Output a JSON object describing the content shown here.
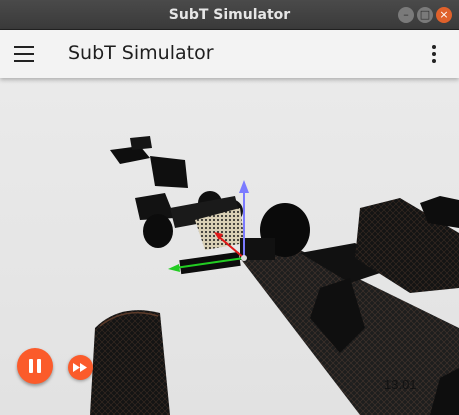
{
  "window": {
    "title": "SubT Simulator",
    "buttons": {
      "minimize": "–",
      "maximize": "□",
      "close": "×"
    }
  },
  "appbar": {
    "title": "SubT Simulator",
    "menu_icon": "hamburger-menu-icon",
    "overflow_icon": "more-vert-icon"
  },
  "playback": {
    "pause_icon": "pause-icon",
    "fast_forward_icon": "fast-forward-icon",
    "prev_icon": "‹",
    "time": "13.01"
  },
  "colors": {
    "accent": "#fb5b2b",
    "appbar_bg": "#f3f3f3",
    "titlebar_bg": "#3c3c3c",
    "viewport_bg": "#e6e6e6",
    "axis_x": "#e01818",
    "axis_y": "#22cc22",
    "axis_z": "#7b7bff"
  }
}
